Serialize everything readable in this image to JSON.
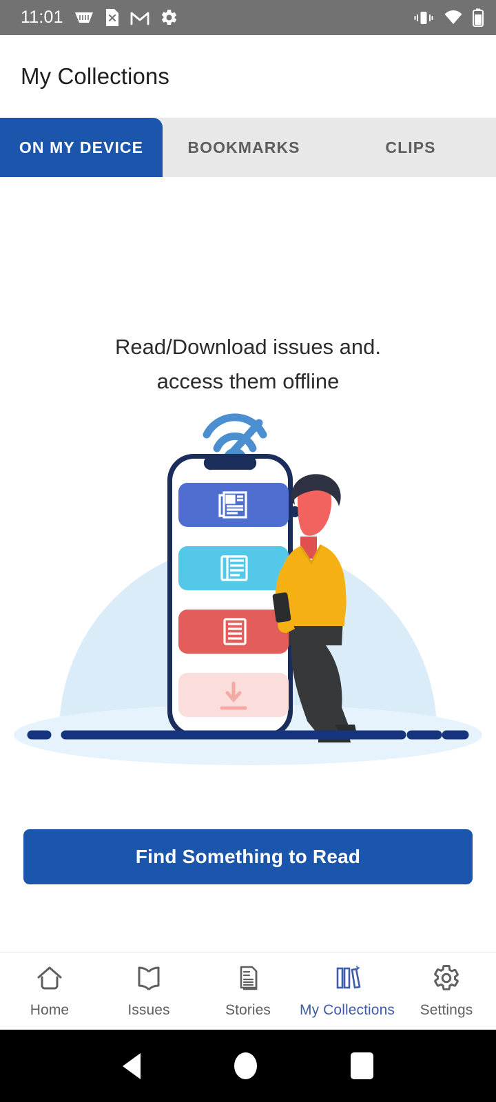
{
  "status_bar": {
    "time": "11:01",
    "left_icons": [
      "wallet-icon",
      "file-x-icon",
      "gmail-icon",
      "gear-icon"
    ],
    "right_icons": [
      "vibrate-icon",
      "wifi-icon",
      "battery-icon"
    ],
    "background": "#727272"
  },
  "app_bar": {
    "title": "My Collections"
  },
  "tabs": {
    "active_index": 0,
    "items": [
      {
        "label": "ON MY DEVICE"
      },
      {
        "label": "BOOKMARKS"
      },
      {
        "label": "CLIPS"
      }
    ],
    "active_color": "#1b55ac",
    "inactive_background": "#e8e8e8",
    "inactive_text_color": "#5d5d5d"
  },
  "empty_state": {
    "line1": "Read/Download issues and.",
    "line2": "access them offline",
    "illustration": {
      "name": "offline-reading-illustration",
      "wifi_off_icon": "wifi-off-icon",
      "wifi_off_color": "#4c8fd1",
      "backdrop_color": "#dbecf9",
      "phone_frame_color": "#1b2d5b",
      "ground_line_color": "#17357f",
      "cards": [
        {
          "name": "newspaper-card",
          "color": "#4f6fd0",
          "icon": "newspaper-icon"
        },
        {
          "name": "magazine-card",
          "color": "#54c8e8",
          "icon": "book-icon"
        },
        {
          "name": "article-card",
          "color": "#e35d5b",
          "icon": "list-icon"
        },
        {
          "name": "download-card",
          "color": "#fbdedc",
          "icon": "download-icon"
        }
      ],
      "person": {
        "name": "person-reading",
        "shirt_color": "#f5b014",
        "pants_color": "#37383a",
        "hair_color": "#2e3141",
        "skin_color": "#f2625f"
      }
    }
  },
  "cta": {
    "label": "Find Something to Read",
    "color": "#1b55ac"
  },
  "bottom_nav": {
    "active_index": 3,
    "active_color": "#3f5ca8",
    "inactive_color": "#5f5f5f",
    "items": [
      {
        "label": "Home",
        "icon": "home-icon"
      },
      {
        "label": "Issues",
        "icon": "book-open-icon"
      },
      {
        "label": "Stories",
        "icon": "article-icon"
      },
      {
        "label": "My Collections",
        "icon": "books-shelf-icon"
      },
      {
        "label": "Settings",
        "icon": "gear-icon"
      }
    ]
  },
  "system_nav": {
    "items": [
      {
        "name": "back-button",
        "icon": "triangle-back-icon"
      },
      {
        "name": "home-button",
        "icon": "circle-home-icon"
      },
      {
        "name": "recents-button",
        "icon": "square-recents-icon"
      }
    ]
  }
}
